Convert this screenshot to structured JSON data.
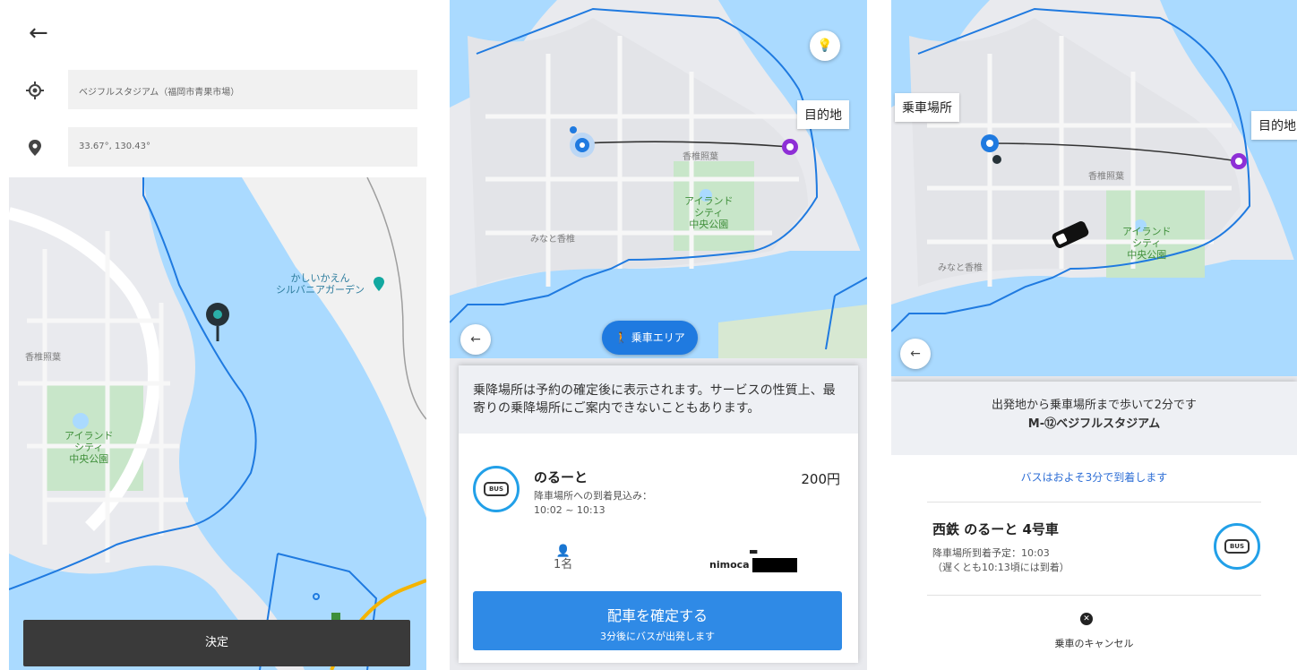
{
  "screen1": {
    "origin_value": "ベジフルスタジアム（福岡市青果市場）",
    "destination_value": "33.67°, 130.43°",
    "map_labels": {
      "park": [
        "アイランド",
        "シティ",
        "中央公園"
      ],
      "garden": [
        "かしいかえん",
        "シルバニアガーデン"
      ],
      "district": "香椎照葉"
    },
    "decide_label": "決定"
  },
  "screen2": {
    "destination_bubble": "目的地",
    "map_labels": {
      "park": [
        "アイランド",
        "シティ",
        "中央公園"
      ],
      "district_a": "香椎照葉",
      "district_b": "みなと香椎"
    },
    "ride_area_label": "乗車エリア",
    "notice": "乗降場所は予約の確定後に表示されます。サービスの性質上、最寄りの乗降場所にご案内できないこともあります。",
    "service": {
      "name": "のるーと",
      "price": "200円",
      "eta_label": "降車場所への到着見込み：",
      "eta_range": "10:02 ~ 10:13",
      "passengers": "1名",
      "payment": "nimoca"
    },
    "confirm_title": "配車を確定する",
    "confirm_sub": "3分後にバスが出発します"
  },
  "screen3": {
    "pickup_bubble": "乗車場所",
    "destination_bubble": "目的地",
    "map_labels": {
      "park": [
        "アイランド",
        "シティ",
        "中央公園"
      ],
      "district_a": "香椎照葉",
      "district_b": "みなと香椎"
    },
    "walk_text": "出発地から乗車場所まで歩いて2分です",
    "stop_name": "M-⑫ベジフルスタジアム",
    "bus_arrival": "バスはおよそ3分で到着します",
    "bus_name": "西鉄 のるーと 4号車",
    "arrival_plan": "降車場所到着予定：10:03",
    "arrival_latest": "（遅くとも10:13頃には到着）",
    "cancel_label": "乗車のキャンセル"
  },
  "colors": {
    "accent": "#2f8ae6",
    "boundary": "#1f7ae0",
    "water": "#aadaff",
    "park": "#c8e6c9",
    "destination_marker": "#8e2fd6"
  }
}
